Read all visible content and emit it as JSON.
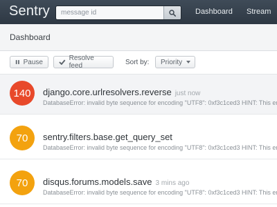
{
  "app": {
    "name": "Sentry"
  },
  "search": {
    "placeholder": "message id",
    "value": ""
  },
  "nav": {
    "items": [
      "Dashboard",
      "Stream"
    ]
  },
  "page": {
    "title": "Dashboard"
  },
  "toolbar": {
    "pause_label": "Pause",
    "resolve_label": "Resolve feed",
    "sort_label": "Sort by:",
    "sort_value": "Priority"
  },
  "events": [
    {
      "count": "140",
      "title": "django.core.urlresolvers.reverse",
      "time": "just now",
      "message": "DatabaseError: invalid byte sequence for encoding \"UTF8\": 0xf3c1ced3 HINT: This error can also happen if",
      "color": "#e8492a"
    },
    {
      "count": "70",
      "title": "sentry.filters.base.get_query_set",
      "time": "",
      "message": "DatabaseError: invalid byte sequence for encoding \"UTF8\": 0xf3c1ced3 HINT: This error can also happen if",
      "color": "#f3a20f"
    },
    {
      "count": "70",
      "title": "disqus.forums.models.save",
      "time": "3 mins ago",
      "message": "DatabaseError: invalid byte sequence for encoding \"UTF8\": 0xf3c1ced3 HINT: This error can also happen if",
      "color": "#f3a20f"
    }
  ],
  "colors": {
    "topbar": "#36414c",
    "critical": "#e8492a",
    "warning": "#f3a20f"
  },
  "icons": {
    "search": "search-icon",
    "pause": "pause-icon",
    "resolve": "checkmark-icon",
    "sort": "chevron-down-icon"
  }
}
